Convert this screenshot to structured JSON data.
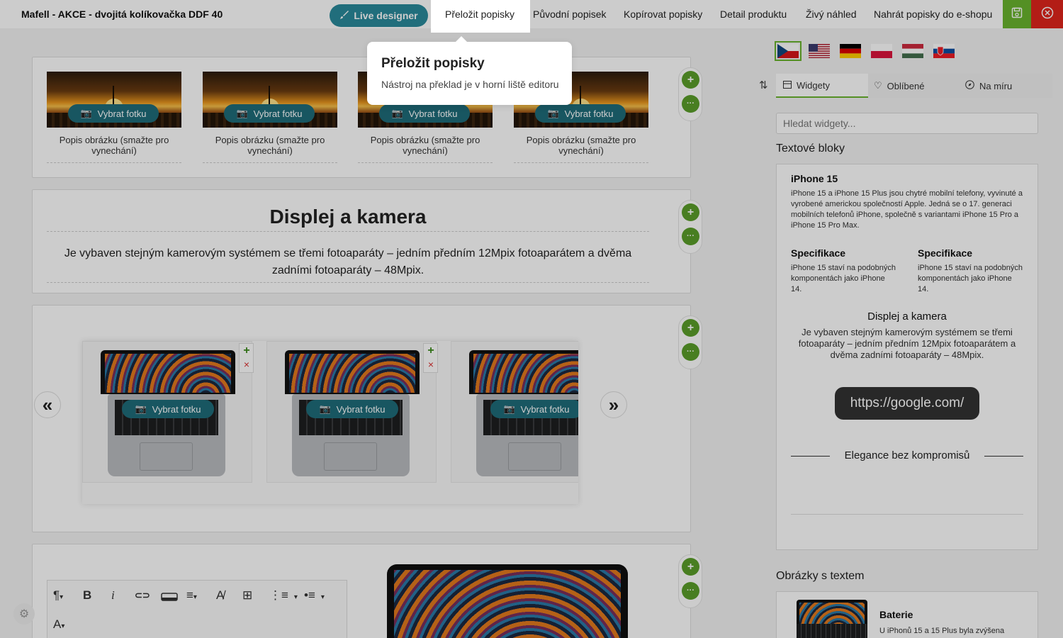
{
  "header": {
    "title": "Mafell - AKCE - dvojitá kolíkovačka DDF 40",
    "live_designer": "Live designer",
    "nav": {
      "translate": "Přeložit popisky",
      "original": "Původní popisek",
      "copy": "Kopírovat popisky",
      "detail": "Detail produktu",
      "preview": "Živý náhled",
      "upload": "Nahrát popisky do e-shopu"
    }
  },
  "tooltip": {
    "title": "Přeložit popisky",
    "text": "Nástroj na překlad je v horní liště editoru"
  },
  "editor": {
    "gallery": {
      "items": [
        {
          "button": "Vybrat fotku",
          "caption": "Popis obrázku (smažte pro vynechání)"
        },
        {
          "button": "Vybrat fotku",
          "caption": "Popis obrázku (smažte pro vynechání)"
        },
        {
          "button": "Vybrat fotku",
          "caption": "Popis obrázku (smažte pro vynechání)"
        },
        {
          "button": "Vybrat fotku",
          "caption": "Popis obrázku (smažte pro vynechání)"
        }
      ]
    },
    "text_block": {
      "heading": "Displej a kamera",
      "body": "Je vybaven stejným kamerovým systémem se třemi fotoaparáty – jedním předním 12Mpix fotoaparátem a dvěma zadními fotoaparáty – 48Mpix."
    },
    "carousel": {
      "items": [
        {
          "button": "Vybrat fotku"
        },
        {
          "button": "Vybrat fotku"
        },
        {
          "button": "Vybrat fotku"
        }
      ],
      "prev": "«",
      "next": "»"
    },
    "controls": {
      "add": "+",
      "more": "···",
      "remove": "×"
    },
    "toolbar": {
      "paragraph": "¶",
      "bold": "B",
      "italic": "i",
      "link": "⊂⊃",
      "align": "≡",
      "clear_format": "A̸",
      "table": "⊞",
      "ordered_list": "⋮≡",
      "bullet_list": "•≡",
      "text_color": "A",
      "caret": "▾"
    }
  },
  "sidebar": {
    "languages": [
      {
        "code": "cs",
        "selected": true
      },
      {
        "code": "en",
        "selected": false
      },
      {
        "code": "de",
        "selected": false
      },
      {
        "code": "pl",
        "selected": false
      },
      {
        "code": "hu",
        "selected": false
      },
      {
        "code": "sk",
        "selected": false
      }
    ],
    "tabs": {
      "widgets": "Widgety",
      "favorites": "Oblíbené",
      "custom": "Na míru"
    },
    "search_placeholder": "Hledat widgety...",
    "section_text_blocks": "Textové bloky",
    "preview": {
      "title": "iPhone 15",
      "intro": "iPhone 15 a iPhone 15 Plus jsou chytré mobilní telefony, vyvinuté a vyrobené americkou společností Apple. Jedná se o 17. generaci mobilních telefonů iPhone, společně s variantami iPhone 15 Pro a iPhone 15 Pro Max.",
      "spec_left_title": "Specifikace",
      "spec_left_text": "iPhone 15 staví na podobných komponentách jako iPhone 14.",
      "spec_right_title": "Specifikace",
      "spec_right_text": "iPhone 15 staví na podobných komponentách jako iPhone 14.",
      "display_title": "Displej a kamera",
      "display_text": "Je vybaven stejným kamerovým systémem se třemi fotoaparáty – jedním předním 12Mpix fotoaparátem a dvěma zadními fotoaparáty – 48Mpix.",
      "link": "https://google.com/",
      "divider": "Elegance bez kompromisů"
    },
    "section_image_text": "Obrázky s textem",
    "battery": {
      "title": "Baterie",
      "text": "U iPhonů 15 a 15 Plus byla zvýšena"
    }
  },
  "colors": {
    "accent": "#6ab42d",
    "teal": "#2a8a9c",
    "danger": "#e0251c"
  }
}
